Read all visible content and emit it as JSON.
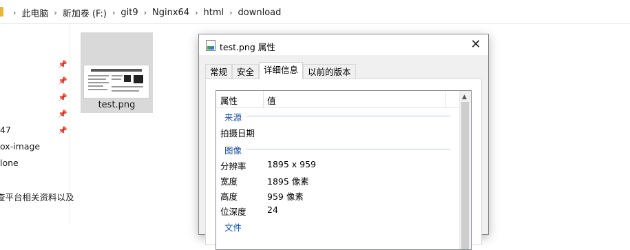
{
  "address_bar": {
    "crumbs": [
      "此电脑",
      "新加卷 (F:)",
      "git9",
      "Nginx64",
      "html",
      "download"
    ]
  },
  "nav_pane": {
    "items": [
      "47",
      "ox-image",
      "lone",
      "查平台相关资料以及"
    ]
  },
  "file": {
    "name": "test.png"
  },
  "dialog": {
    "title": "test.png 属性",
    "close_glyph": "✕",
    "tabs": [
      "常规",
      "安全",
      "详细信息",
      "以前的版本"
    ],
    "active_tab": "详细信息",
    "columns": [
      "属性",
      "值"
    ],
    "groups": {
      "source": "来源",
      "image": "图像",
      "file_partial": "文件"
    },
    "rows": {
      "date_taken": {
        "label": "拍摄日期",
        "value": ""
      },
      "dimensions": {
        "label": "分辨率",
        "value": "1895 x 959"
      },
      "width": {
        "label": "宽度",
        "value": "1895 像素"
      },
      "height": {
        "label": "高度",
        "value": "959 像素"
      },
      "bit_depth": {
        "label": "位深度",
        "value": "24"
      }
    }
  },
  "colors": {
    "group_text": "#1c4fa3",
    "tile_selected": "#d9d9d9",
    "folder_icon": "#e8b73a"
  }
}
